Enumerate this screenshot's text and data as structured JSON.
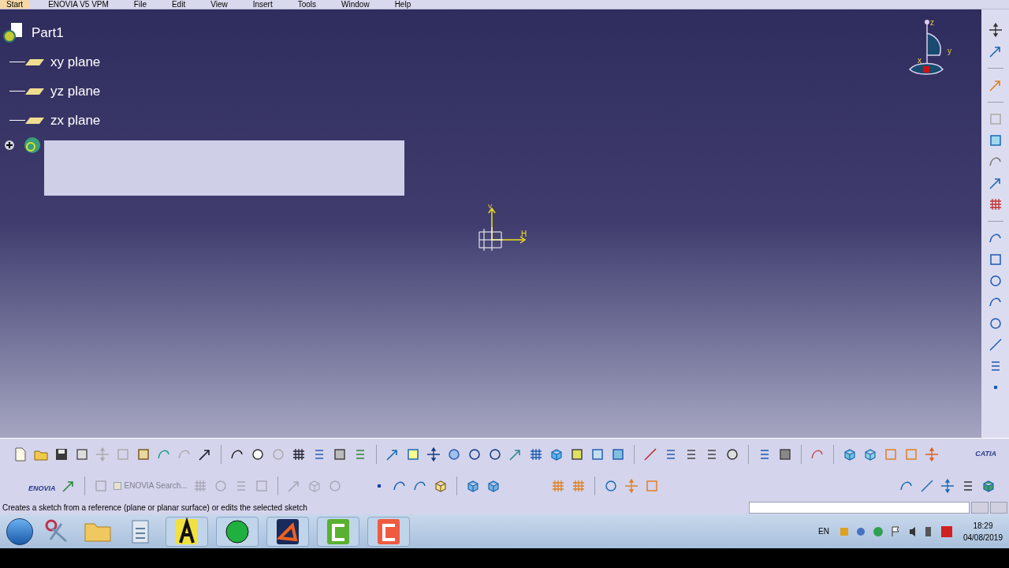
{
  "menu_bar": {
    "items": [
      {
        "label": "Start",
        "selected": true
      },
      {
        "label": "ENOVIA V5 VPM",
        "selected": false
      },
      {
        "label": "File",
        "selected": false
      },
      {
        "label": "Edit",
        "selected": false
      },
      {
        "label": "View",
        "selected": false
      },
      {
        "label": "Insert",
        "selected": false
      },
      {
        "label": "Tools",
        "selected": false
      },
      {
        "label": "Window",
        "selected": false
      },
      {
        "label": "Help",
        "selected": false
      }
    ]
  },
  "tree": {
    "root": "Part1",
    "children": [
      {
        "label": "xy plane",
        "kind": "plane"
      },
      {
        "label": "yz plane",
        "kind": "plane"
      },
      {
        "label": "zx plane",
        "kind": "plane"
      },
      {
        "kind": "body",
        "expanded": false
      }
    ]
  },
  "compass": {
    "axes": [
      "z",
      "y",
      "x"
    ]
  },
  "axis_system": {
    "labels": [
      "V",
      "H"
    ]
  },
  "toolbar": {
    "enovia_logo": "ENOVIA",
    "catia_logo": "CATIA",
    "search": {
      "label": "ENOVIA Search...",
      "disabled": true
    }
  },
  "status_bar": {
    "message": "Creates a sketch from a reference (plane or planar surface) or edits the selected sketch"
  },
  "taskbar": {
    "language": "EN",
    "time": "18:29",
    "date": "04/08/2019"
  }
}
